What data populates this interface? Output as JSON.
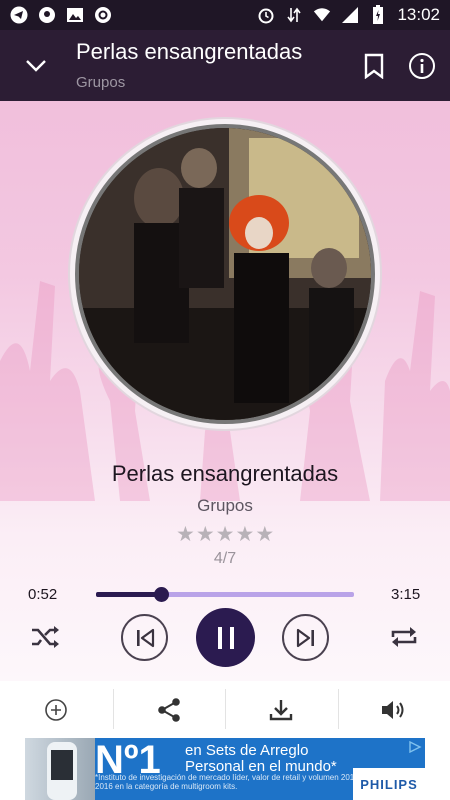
{
  "status_bar": {
    "time": "13:02"
  },
  "app_bar": {
    "title": "Perlas ensangrentadas",
    "subtitle": "Grupos"
  },
  "player": {
    "song_title": "Perlas ensangrentadas",
    "artist": "Grupos",
    "rating": 0,
    "rating_max": 5,
    "counter": "4/7",
    "time_current": "0:52",
    "time_total": "3:15",
    "progress": 0.25
  },
  "actions": [
    "add-icon",
    "share-icon",
    "download-icon",
    "volume-icon"
  ],
  "ad": {
    "rank": "Nº1",
    "headline": "en Sets de Arreglo Personal en el mundo*",
    "fineprint": "*Instituto de investigación de mercado líder, valor de retail y volumen 2015-2016 en la categoría de multigroom kits.",
    "brand": "PHILIPS"
  },
  "colors": {
    "status_bar_bg": "#1f1626",
    "app_bar_bg": "#2c1d34",
    "accent": "#2b1b50",
    "track": "#b9a3e8",
    "ad_bg": "#1e73c8"
  }
}
